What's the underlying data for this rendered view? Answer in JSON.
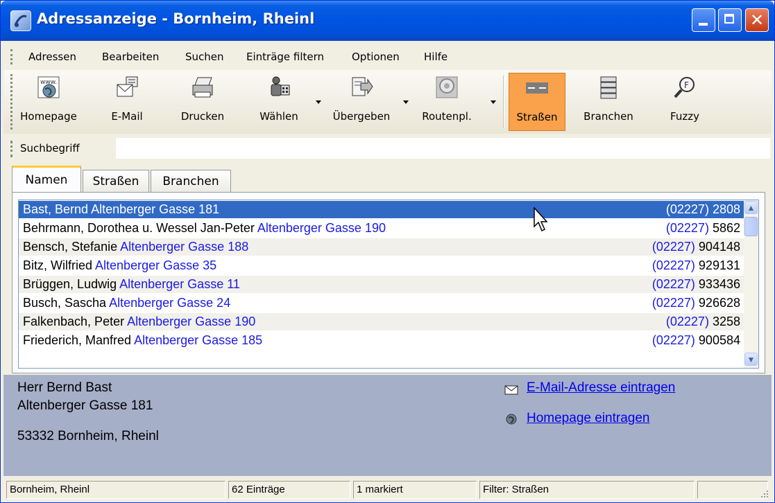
{
  "window": {
    "title": "Adressanzeige - Bornheim, Rheinl"
  },
  "menu": [
    "Adressen",
    "Bearbeiten",
    "Suchen",
    "Einträge filtern",
    "Optionen",
    "Hilfe"
  ],
  "toolbar": {
    "homepage": "Homepage",
    "email": "E-Mail",
    "print": "Drucken",
    "dial": "Wählen",
    "transfer": "Übergeben",
    "route": "Routenpl.",
    "streets": "Straßen",
    "branches": "Branchen",
    "fuzzy": "Fuzzy",
    "homepage_icon_text": "www."
  },
  "search": {
    "label": "Suchbegriff",
    "value": ""
  },
  "tabs": [
    "Namen",
    "Straßen",
    "Branchen"
  ],
  "list": [
    {
      "name": "Bast, Bernd",
      "address": "Altenberger Gasse 181",
      "area": "(02227)",
      "number": "2808"
    },
    {
      "name": "Behrmann, Dorothea u. Wessel Jan-Peter",
      "address": "Altenberger Gasse 190",
      "area": "(02227)",
      "number": "5862"
    },
    {
      "name": "Bensch, Stefanie",
      "address": "Altenberger Gasse 188",
      "area": "(02227)",
      "number": "904148"
    },
    {
      "name": "Bitz, Wilfried",
      "address": "Altenberger Gasse 35",
      "area": "(02227)",
      "number": "929131"
    },
    {
      "name": "Brüggen, Ludwig",
      "address": "Altenberger Gasse 11",
      "area": "(02227)",
      "number": "933436"
    },
    {
      "name": "Busch, Sascha",
      "address": "Altenberger Gasse 24",
      "area": "(02227)",
      "number": "926628"
    },
    {
      "name": "Falkenbach, Peter",
      "address": "Altenberger Gasse 190",
      "area": "(02227)",
      "number": "3258"
    },
    {
      "name": "Friederich, Manfred",
      "address": "Altenberger Gasse 185",
      "area": "(02227)",
      "number": "900584"
    }
  ],
  "detail": {
    "salutation": "Herr Bernd Bast",
    "street": "Altenberger Gasse 181",
    "city": "53332 Bornheim, Rheinl",
    "email_link": "E-Mail-Adresse eintragen",
    "homepage_link": "Homepage eintragen"
  },
  "status": {
    "location": "Bornheim, Rheinl",
    "count": "62 Einträge",
    "marked": "1 markiert",
    "filter": "Filter: Straßen"
  },
  "colors": {
    "selection": "#316ac5",
    "address_link": "#1a1ae6",
    "active_tool": "#f9a24b",
    "detail_bg": "#a6afc8"
  }
}
